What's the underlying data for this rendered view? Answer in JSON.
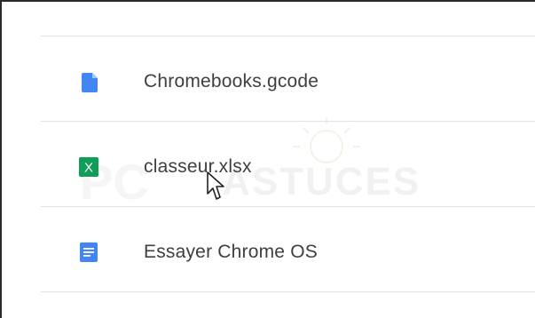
{
  "files": [
    {
      "name": "Chromebooks.gcode",
      "icon": "file-icon",
      "color": "#4285f4"
    },
    {
      "name": "classeur.xlsx",
      "icon": "excel-x-icon",
      "color": "#0f9d58",
      "glyph": "X"
    },
    {
      "name": "Essayer Chrome OS",
      "icon": "google-doc-icon",
      "color": "#4285f4"
    }
  ],
  "watermark": {
    "prefix": "PC",
    "text": "ASTUCES"
  }
}
